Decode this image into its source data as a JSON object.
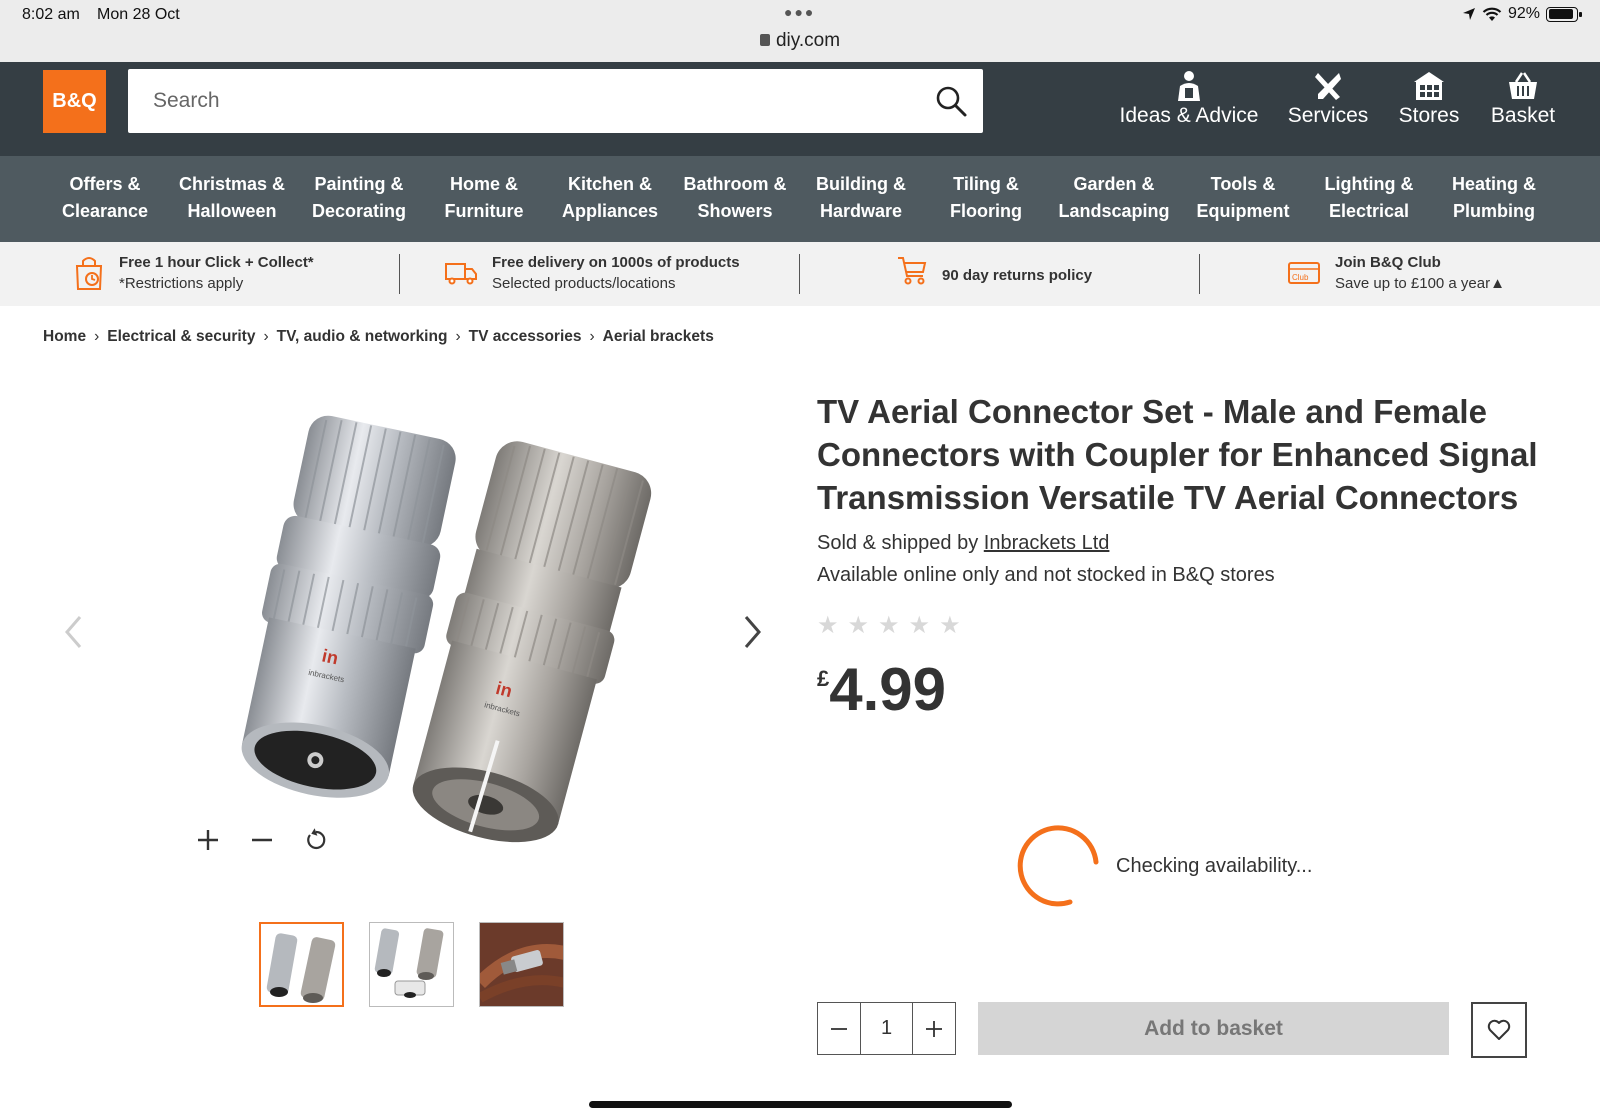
{
  "status_bar": {
    "time": "8:02 am",
    "date": "Mon 28 Oct",
    "url": "diy.com",
    "battery": "92%"
  },
  "header": {
    "logo_text": "B&Q",
    "search_placeholder": "Search",
    "nav": [
      {
        "label": "Ideas & Advice",
        "icon": "advisor-icon"
      },
      {
        "label": "Services",
        "icon": "tools-icon"
      },
      {
        "label": "Stores",
        "icon": "store-icon"
      },
      {
        "label": "Basket",
        "icon": "basket-icon"
      }
    ]
  },
  "categories": [
    {
      "line1": "Offers &",
      "line2": "Clearance"
    },
    {
      "line1": "Christmas &",
      "line2": "Halloween"
    },
    {
      "line1": "Painting &",
      "line2": "Decorating"
    },
    {
      "line1": "Home &",
      "line2": "Furniture"
    },
    {
      "line1": "Kitchen &",
      "line2": "Appliances"
    },
    {
      "line1": "Bathroom &",
      "line2": "Showers"
    },
    {
      "line1": "Building &",
      "line2": "Hardware"
    },
    {
      "line1": "Tiling &",
      "line2": "Flooring"
    },
    {
      "line1": "Garden &",
      "line2": "Landscaping"
    },
    {
      "line1": "Tools &",
      "line2": "Equipment"
    },
    {
      "line1": "Lighting &",
      "line2": "Electrical"
    },
    {
      "line1": "Heating &",
      "line2": "Plumbing"
    }
  ],
  "usp": [
    {
      "title": "Free 1 hour Click + Collect*",
      "sub": "*Restrictions apply",
      "icon": "click-collect-icon"
    },
    {
      "title": "Free delivery on 1000s of products",
      "sub": "Selected products/locations",
      "icon": "delivery-truck-icon"
    },
    {
      "title": "90 day returns policy",
      "sub": "",
      "icon": "returns-trolley-icon"
    },
    {
      "title": "Join B&Q Club",
      "sub": "Save up to £100 a year▲",
      "icon": "club-card-icon"
    }
  ],
  "breadcrumb": [
    "Home",
    "Electrical & security",
    "TV, audio & networking",
    "TV accessories",
    "Aerial brackets"
  ],
  "product": {
    "title": "TV Aerial Connector Set - Male and Female Connectors with Coupler for Enhanced Signal Transmission Versatile TV Aerial Connectors",
    "sold_prefix": "Sold & shipped by ",
    "seller": "Inbrackets Ltd",
    "availability": "Available online only and not stocked in B&Q stores",
    "rating": 0,
    "rating_max": 5,
    "currency": "£",
    "price": "4.99",
    "image_brand": "in",
    "image_brand_sub": "inbrackets"
  },
  "stock": {
    "checking_text": "Checking availability..."
  },
  "purchase": {
    "quantity": "1",
    "add_label": "Add to basket"
  },
  "colors": {
    "brand_orange": "#f4701b",
    "header_dark": "#353e44",
    "nav_grey": "#4f5a60",
    "button_disabled": "#d5d5d5"
  }
}
